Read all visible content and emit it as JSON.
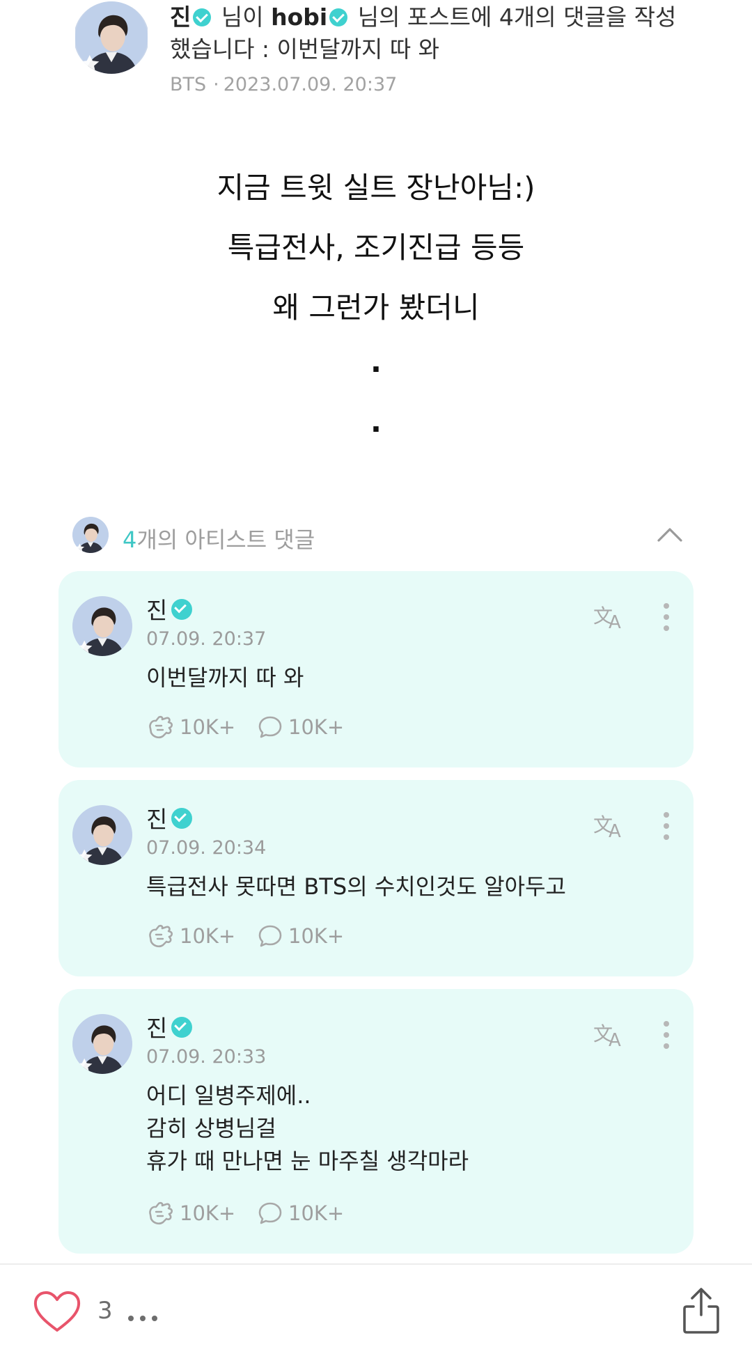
{
  "header": {
    "author": "진",
    "text_1": "님이",
    "target": "hobi",
    "text_2": "님의 포스트에 4개의 댓글을 작성",
    "text_3": "했습니다 : 이번달까지 따 와",
    "community": "BTS",
    "date_separator": "·",
    "datetime": "2023.07.09. 20:37"
  },
  "post": {
    "lines": [
      "지금 트윗 실트 장난아님:)",
      "특급전사, 조기진급 등등",
      "왜 그런가 봤더니",
      ".",
      "."
    ]
  },
  "artist_comments": {
    "count": "4",
    "label": "개의 아티스트 댓글",
    "items": [
      {
        "author": "진",
        "time": "07.09. 20:37",
        "lines": [
          "이번달까지 따 와"
        ],
        "likes": "10K+",
        "replies": "10K+"
      },
      {
        "author": "진",
        "time": "07.09. 20:34",
        "lines": [
          "특급전사 못따면 BTS의 수치인것도 알아두고"
        ],
        "likes": "10K+",
        "replies": "10K+"
      },
      {
        "author": "진",
        "time": "07.09. 20:33",
        "lines": [
          "어디 일병주제에..",
          "감히 상병님걸",
          "휴가 때 만나면 눈 마주칠 생각마라"
        ],
        "likes": "10K+",
        "replies": "10K+"
      }
    ]
  },
  "bottom_bar": {
    "like_count": "3"
  },
  "icons": {
    "verified": "verified-badge-icon",
    "translate": "translate-icon",
    "more": "more-vertical-icon",
    "like": "cheer-hand-icon",
    "reply": "comment-bubble-icon",
    "collapse": "chevron-up-icon",
    "heart": "heart-outline-icon",
    "share": "share-icon"
  },
  "colors": {
    "accent": "#3fd1cf",
    "comment_card_bg": "#e7fbf8",
    "heart": "#e8546b"
  }
}
